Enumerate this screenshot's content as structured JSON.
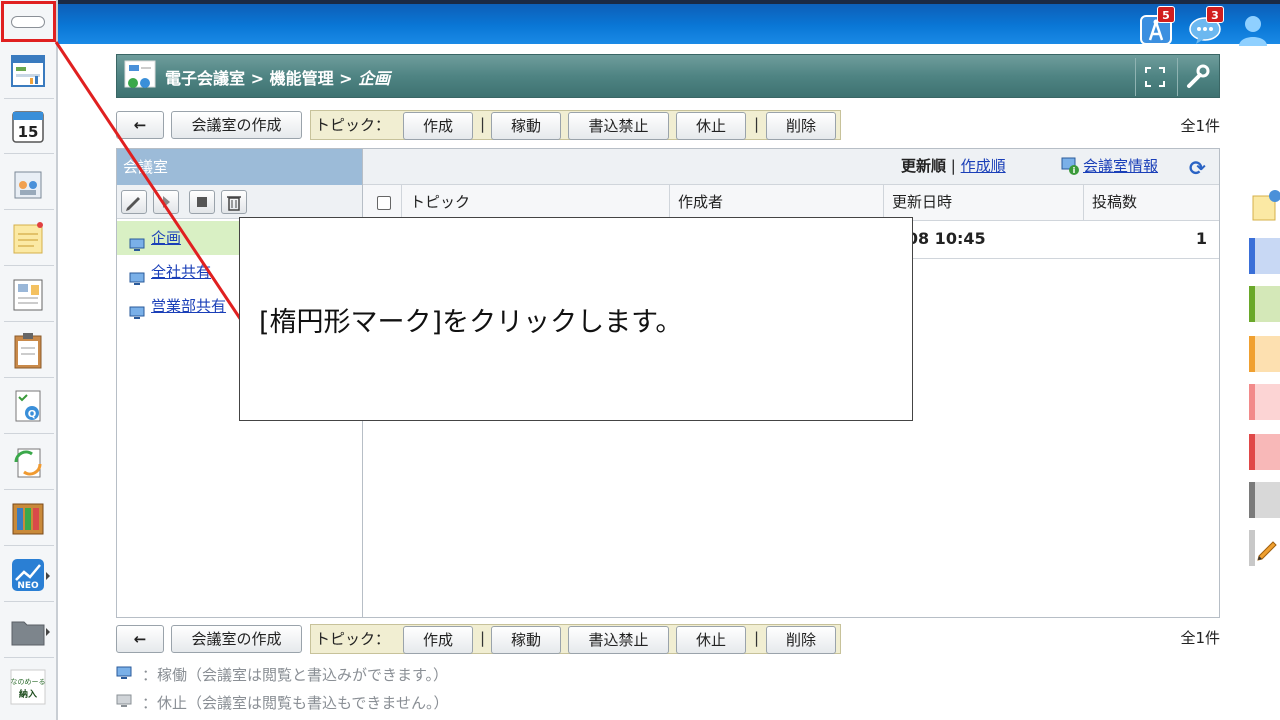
{
  "header": {
    "notifications": {
      "icon": "antenna-icon",
      "count": "5"
    },
    "messages": {
      "icon": "chat-bubble-icon",
      "count": "3"
    },
    "user": {
      "icon": "user-icon"
    }
  },
  "rail": {
    "items": [
      {
        "name": "ellipse-mark-icon"
      },
      {
        "name": "portal-icon"
      },
      {
        "name": "calendar-icon",
        "text": "15"
      },
      {
        "name": "facility-icon"
      },
      {
        "name": "memo-icon"
      },
      {
        "name": "bulletin-icon"
      },
      {
        "name": "clipboard-icon"
      },
      {
        "name": "survey-icon"
      },
      {
        "name": "workflow-icon"
      },
      {
        "name": "cabinet-icon"
      },
      {
        "name": "neo-icon",
        "text": "NEO"
      },
      {
        "name": "folder-icon"
      },
      {
        "name": "namecard-icon",
        "text": "なのめーる 納入"
      }
    ]
  },
  "breadcrumb": {
    "root": "電子会議室",
    "sep1": " > ",
    "middle": "機能管理",
    "sep2": " > ",
    "current": "企画"
  },
  "toolbar": {
    "back_label": "←",
    "create_room": "会議室の作成",
    "topic_label": "トピック：",
    "create": "作成",
    "pipe": "|",
    "activate": "稼動",
    "no_write": "書込禁止",
    "pause": "休止",
    "delete": "削除",
    "count": "全1件"
  },
  "left_panel": {
    "header": "会議室",
    "rooms": [
      {
        "label": "企画",
        "selected": true
      },
      {
        "label": "全社共有",
        "selected": false
      },
      {
        "label": "営業部共有",
        "selected": false
      }
    ]
  },
  "sortbar": {
    "updated_order": "更新順",
    "divider": "|",
    "created_order": "作成順",
    "room_info": "会議室情報"
  },
  "table": {
    "columns": [
      "トピック",
      "作成者",
      "更新日時",
      "投稿数"
    ],
    "rows": [
      {
        "topic": "",
        "author": "",
        "updated": "/08 10:45",
        "posts": "1"
      }
    ]
  },
  "legend": {
    "active": "：稼働（会議室は閲覧と書込みができます。）",
    "paused": "：休止（会議室は閲覧も書込もできません。）"
  },
  "callout": {
    "text": "[楕円形マーク]をクリックします。"
  },
  "colors": {
    "accent_red": "#e02020",
    "header_blue": "#0a77d6",
    "crumb_teal": "#4f8483"
  }
}
